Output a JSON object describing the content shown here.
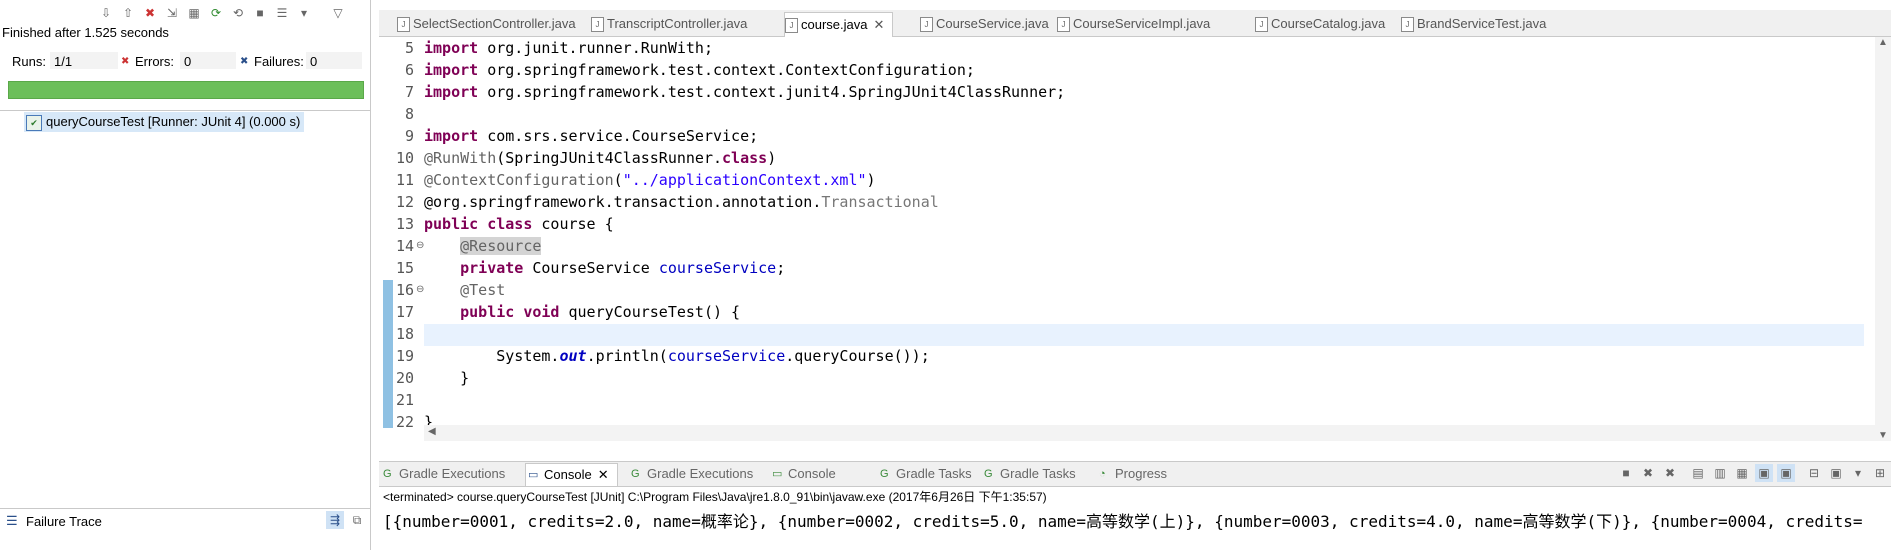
{
  "junit": {
    "status": "Finished after 1.525 seconds",
    "runs_label": "Runs:",
    "runs_value": "1/1",
    "errors_label": "Errors:",
    "errors_value": "0",
    "failures_label": "Failures:",
    "failures_value": "0",
    "progress": 1.0,
    "test_item": "queryCourseTest [Runner: JUnit 4] (0.000 s)",
    "failure_trace_label": "Failure Trace"
  },
  "editor_tabs": [
    {
      "label": "SelectSectionController.java",
      "active": false
    },
    {
      "label": "TranscriptController.java",
      "active": false
    },
    {
      "label": "course.java",
      "active": true
    },
    {
      "label": "CourseService.java",
      "active": false
    },
    {
      "label": "CourseServiceImpl.java",
      "active": false
    },
    {
      "label": "CourseCatalog.java",
      "active": false
    },
    {
      "label": "BrandServiceTest.java",
      "active": false
    }
  ],
  "close_glyph": "✕",
  "line_numbers": [
    "5",
    "6",
    "7",
    "8",
    "9",
    "10",
    "11",
    "12",
    "13",
    "14",
    "15",
    "16",
    "17",
    "18",
    "19",
    "20",
    "21",
    "22"
  ],
  "code": {
    "l5a": "import",
    "l5b": " org.junit.runner.RunWith;",
    "l6a": "import",
    "l6b": " org.springframework.test.context.ContextConfiguration;",
    "l7a": "import",
    "l7b": " org.springframework.test.context.junit4.SpringJUnit4ClassRunner;",
    "l9a": "import",
    "l9b": " com.srs.service.CourseService;",
    "l10a": "@RunWith",
    "l10b": "(SpringJUnit4ClassRunner.",
    "l10c": "class",
    "l10d": ")",
    "l11a": "@ContextConfiguration",
    "l11b": "(",
    "l11c": "\"../applicationContext.xml\"",
    "l11d": ")",
    "l12a": "@org.springframework.transaction.annotation.",
    "l12b": "Transactional",
    "l13a": "public",
    "l13b": " ",
    "l13c": "class",
    "l13d": " course {",
    "l14a": "    ",
    "l14b": "@Resource",
    "l15a": "    ",
    "l15b": "private",
    "l15c": " CourseService ",
    "l15d": "courseService",
    "l15e": ";",
    "l16a": "    ",
    "l16b": "@Test",
    "l17a": "    ",
    "l17b": "public",
    "l17c": " ",
    "l17d": "void",
    "l17e": " queryCourseTest() {",
    "l19a": "        System.",
    "l19b": "out",
    "l19c": ".println(",
    "l19d": "courseService",
    "l19e": ".queryCourse());",
    "l20a": "    }",
    "l22a": "}"
  },
  "console_tabs": [
    {
      "label": "Gradle Executions",
      "active": false
    },
    {
      "label": "Console",
      "active": true
    },
    {
      "label": "Gradle Executions",
      "active": false
    },
    {
      "label": "Console",
      "active": false
    },
    {
      "label": "Gradle Tasks",
      "active": false
    },
    {
      "label": "Gradle Tasks",
      "active": false
    },
    {
      "label": "Progress",
      "active": false
    }
  ],
  "terminated": "<terminated> course.queryCourseTest [JUnit] C:\\Program Files\\Java\\jre1.8.0_91\\bin\\javaw.exe (2017年6月26日 下午1:35:57)",
  "console_output": "[{number=0001, credits=2.0, name=概率论}, {number=0002, credits=5.0, name=高等数学(上)}, {number=0003, credits=4.0, name=高等数学(下)}, {number=0004, credits=",
  "colors": {
    "progress": "#6cbf5a",
    "keyword": "#7f0055",
    "string": "#2a00ff",
    "field": "#0000c0",
    "annotation": "#646464"
  }
}
